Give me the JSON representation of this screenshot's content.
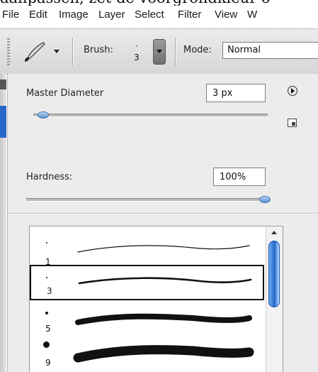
{
  "top_text": "aanpassen, zet de voorgrondkleur o",
  "menu": [
    "File",
    "Edit",
    "Image",
    "Layer",
    "Select",
    "Filter",
    "View",
    "W"
  ],
  "options_bar": {
    "tool_icon": "brush-icon",
    "brush_label": "Brush:",
    "brush_size": "3",
    "mode_label": "Mode:",
    "mode_value": "Normal"
  },
  "panel": {
    "master_diameter_label": "Master Diameter",
    "master_diameter_value": "3 px",
    "master_diameter_slider": 0.04,
    "hardness_label": "Hardness:",
    "hardness_value": "100%",
    "hardness_slider": 1.0,
    "menu_icon": "panel-menu-arrow-icon",
    "new_preset_icon": "new-preset-icon"
  },
  "brushes": [
    {
      "size": "1",
      "selected": false
    },
    {
      "size": "3",
      "selected": true
    },
    {
      "size": "5",
      "selected": false
    },
    {
      "size": "9",
      "selected": false
    }
  ],
  "colors": {
    "accent": "#2a66c7",
    "scroll_thumb": "#2167c9"
  }
}
